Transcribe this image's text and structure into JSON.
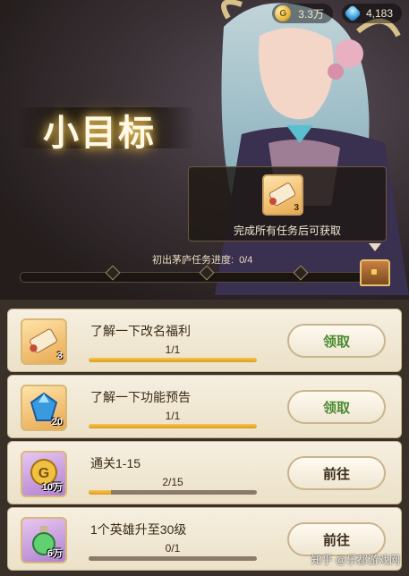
{
  "resources": {
    "gold": {
      "value": "3.3万",
      "icon": "gold-coin-icon",
      "icon_letter": "G"
    },
    "gem": {
      "value": "4,183",
      "icon": "blue-gem-icon"
    }
  },
  "header": {
    "title": "小目标"
  },
  "reward": {
    "icon": "scroll-icon",
    "count": "3",
    "text": "完成所有任务后可获取"
  },
  "progress": {
    "label": "初出茅庐任务进度:",
    "value": "0/4",
    "fraction": 0.0
  },
  "tasks": [
    {
      "name": "了解一下改名福利",
      "ratio": "1/1",
      "progress": 1.0,
      "icon": "scroll-icon",
      "icon_count": "3",
      "button": "领取",
      "button_type": "claim"
    },
    {
      "name": "了解一下功能预告",
      "ratio": "1/1",
      "progress": 1.0,
      "icon": "blue-gem-icon",
      "icon_count": "20",
      "button": "领取",
      "button_type": "claim"
    },
    {
      "name": "通关1-15",
      "ratio": "2/15",
      "progress": 0.1333,
      "icon": "gold-coin-icon",
      "icon_count": "10万",
      "button": "前往",
      "button_type": "go"
    },
    {
      "name": "1个英雄升至30级",
      "ratio": "0/1",
      "progress": 0.0,
      "icon": "green-potion-icon",
      "icon_count": "6万",
      "button": "前往",
      "button_type": "go"
    }
  ],
  "watermark": "知乎 @乐都游戏网",
  "colors": {
    "claim_text": "#4a8a30",
    "gold": "#e5b53a",
    "progress_fill": "#f6c64a"
  }
}
